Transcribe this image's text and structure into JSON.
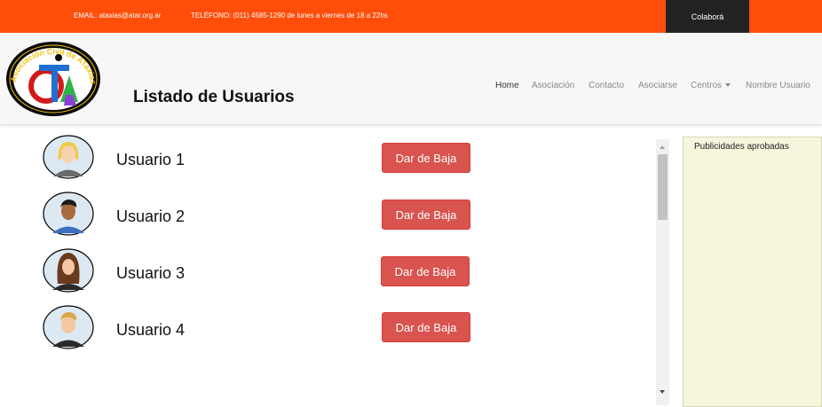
{
  "topbar": {
    "email": "EMAIL: ataxias@atar.org.ar",
    "phone": "TELÉFONO: (011) 4585-1290 de lunes a viernes de 18 a 22hs",
    "colabora": "Colaborá"
  },
  "header": {
    "logo_text": "Asociación Civil de ATaxias de ARgentina",
    "page_title": "Listado de Usuarios",
    "nav": {
      "home": "Home",
      "asociacion": "Asociación",
      "contacto": "Contacto",
      "asociarse": "Asociarse",
      "centros": "Centros",
      "usuario": "Nombre Usuario"
    }
  },
  "users": [
    {
      "name": "Usuario 1",
      "avatar": "blonde-woman-avatar",
      "action": "Dar de Baja"
    },
    {
      "name": "Usuario 2",
      "avatar": "dark-haired-man-avatar",
      "action": "Dar de Baja"
    },
    {
      "name": "Usuario 3",
      "avatar": "brunette-woman-avatar",
      "action": "Dar de Baja"
    },
    {
      "name": "Usuario 4",
      "avatar": "blond-man-avatar",
      "action": "Dar de Baja"
    }
  ],
  "ads": {
    "title": "Publicidades aprobadas"
  },
  "colors": {
    "topbar": "#ff4e0a",
    "colabora_bg": "#222222",
    "danger": "#d9534f",
    "ads_bg": "#f5f6dc"
  }
}
